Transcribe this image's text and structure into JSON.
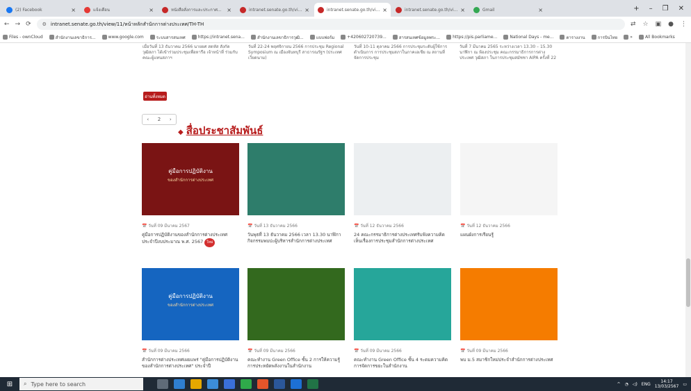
{
  "browser": {
    "tabs": [
      {
        "title": "(2) Facebook",
        "color": "#1877f2",
        "active": false
      },
      {
        "title": "แจ้งเตือน",
        "color": "#e53935",
        "active": false
      },
      {
        "title": "หนังสือสั่งการและประกาศ...",
        "color": "#c62828",
        "active": false
      },
      {
        "title": "intranet.senate.go.th/vie...",
        "color": "#c62828",
        "active": false
      },
      {
        "title": "intranet.senate.go.th/view/11/...",
        "color": "#c62828",
        "active": true
      },
      {
        "title": "intranet.senate.go.th/view/11/...",
        "color": "#c62828",
        "active": false
      },
      {
        "title": "Gmail",
        "color": "#34a853",
        "active": false
      }
    ],
    "new_tab": "+",
    "minimize": "–",
    "maximize": "❐",
    "close": "✕",
    "url": "intranet.senate.go.th/view/11/หน้าหลักสำนักการต่างประเทศ/TH-TH",
    "bookmarks": [
      "Files - ownCloud",
      "สำนักงานเลขาธิการ...",
      "www.google.com",
      "ระบบสารสนเทศ",
      "https://intranet.sena...",
      "สำนักงานเลขาธิการวุฒิ...",
      "แบบฟอร์ม",
      "+420602720739...",
      "สารสนเทศข้อมูลพระ...",
      "https://pis.parliame...",
      "National Days - me...",
      "ตารางงาน",
      "การบินไทย",
      "»",
      "All Bookmarks"
    ]
  },
  "page": {
    "news": [
      "เมื่อวันที่ 13 ธันวาคม 2566 นายยศ สดหัส สังกัดวุฒิสภา ได้เข้าร่วมประชุมเพื่อหารือ เจ้าหน้าที่ ร่วมกับคณะผู้แทนสภาฯ",
      "วันที่ 22-24 พฤศจิกายน 2566 การประชุม Regional Symposium ณ เมืองจันทบุรี สาธารณรัฐฯ (ประเทศเวียดนาม)",
      "วันที่ 10-11 ตุลาคม 2566 การประชุมระดับผู้ใช้การดำเนินการ การประชุมสภาในภาคเอเชีย ณ สถานที่จัดการประชุม",
      "วันที่ 7 มีนาคม 2565 ระหว่างเวลา 13.30 – 15.30 นาฬิกา ณ ห้องประชุม คณะกรรมาธิการการต่างประเทศ วุฒิสภา ในการประชุมสมัชชา AIPA ครั้งที่ 22"
    ],
    "more_button": "อ่านทั้งหมด",
    "pager": {
      "page": "2",
      "left": "‹",
      "right": "›"
    },
    "section_title": "สื่อประชาสัมพันธ์",
    "cards": [
      {
        "date": "วันที่ 09 มีนาคม 2567",
        "title": "คู่มือการปฏิบัติงานของสำนักการต่างประเทศ ประจำปีงบประมาณ พ.ศ. 2567",
        "new": "ใหม่",
        "img_title": "คู่มือการปฏิบัติงาน",
        "img_sub": "ของสำนักการต่างประเทศ",
        "bg": "#7a1414"
      },
      {
        "date": "วันที่ 13 ธันวาคม 2566",
        "title": "วันพุธที่ 13 ธันวาคม 2566 เวลา 13.30 นาฬิกา กิจกรรมพบปะผู้บริหารสำนักการต่างประเทศ",
        "new": "",
        "img_title": "",
        "img_sub": "",
        "bg": "#2e7d6b"
      },
      {
        "date": "วันที่ 12 ธันวาคม 2566",
        "title": "24 คณะกรรมาธิการต่างประเทศรับฟังความคิดเห็นเรื่องการประชุมสำนักการต่างประเทศ",
        "new": "",
        "img_title": "",
        "img_sub": "",
        "bg": "#eceff1"
      },
      {
        "date": "วันที่ 12 ธันวาคม 2566",
        "title": "แผนผังการเรียนรู้",
        "new": "",
        "img_title": "",
        "img_sub": "",
        "bg": "#f5f5f5"
      },
      {
        "date": "วันที่ 09 มีนาคม 2566",
        "title": "สำนักการต่างประเทศเผยแพร่ \"คู่มือการปฏิบัติงานของสำนักการต่างประเทศ\" ประจำปี",
        "new": "",
        "img_title": "คู่มือการปฏิบัติงาน",
        "img_sub": "ของสำนักการต่างประเทศ",
        "bg": "#1565c0"
      },
      {
        "date": "วันที่ 09 มีนาคม 2566",
        "title": "คณะทำงาน Green Office ชั้น 2 การให้ความรู้การประหยัดพลังงานในสำนักงาน",
        "new": "",
        "img_title": "",
        "img_sub": "",
        "bg": "#33691e"
      },
      {
        "date": "วันที่ 09 มีนาคม 2566",
        "title": "คณะทำงาน Green Office ชั้น 4 ระดมความคิดการจัดการขยะในสำนักงาน",
        "new": "",
        "img_title": "",
        "img_sub": "",
        "bg": "#26a69a"
      },
      {
        "date": "วันที่ 09 มีนาคม 2566",
        "title": "พบ ม.5 สมาชิกใหม่ประจำสำนักการต่างประเทศ",
        "new": "",
        "img_title": "",
        "img_sub": "",
        "bg": "#f57c00"
      }
    ]
  },
  "taskbar": {
    "search_placeholder": "Type here to search",
    "time": "14:17",
    "date": "13/03/2567",
    "lang": "ENG"
  }
}
